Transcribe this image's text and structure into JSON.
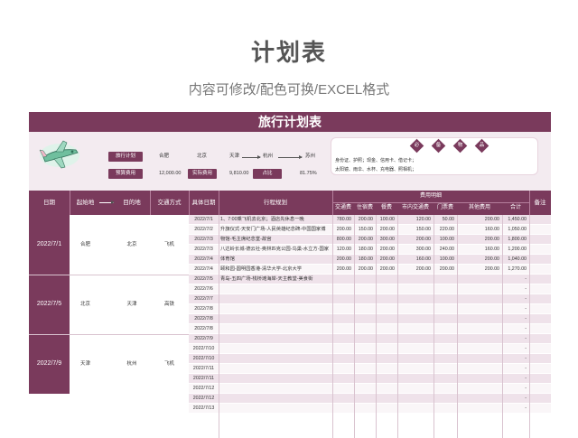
{
  "header": {
    "title": "计划表",
    "subtitle": "内容可修改/配色可换/EXCEL格式"
  },
  "sheet": {
    "banner_title": "旅行计划表",
    "summary": {
      "travel_plan_label": "旅行计划",
      "route": [
        "合肥",
        "北京",
        "天津",
        "杭州",
        "苏州"
      ],
      "budget_label": "预算费用",
      "budget_value": "12,000.00",
      "actual_label": "实际费用",
      "actual_value": "9,810.00",
      "ratio_label": "占比",
      "ratio_value": "81.75%"
    },
    "necessities": {
      "title_chars": [
        "必",
        "备",
        "物",
        "品"
      ],
      "line1": "身份证、护照；现金、信用卡、借记卡；",
      "line2": "太阳镜、雨伞、水杯、充电器、照相机；"
    },
    "columns": {
      "date": "日期",
      "origin": "起始地",
      "destination": "目的地",
      "transport": "交通方式",
      "specific_date": "具体日期",
      "itinerary": "行程规划",
      "expense_group": "费用明细",
      "expense_cols": [
        "交通费",
        "住宿费",
        "餐费",
        "市内交通费",
        "门票费",
        "其他费用",
        "合计"
      ],
      "remarks": "备注"
    },
    "groups": [
      {
        "date": "2022/7/1",
        "origin": "合肥",
        "destination": "北京",
        "transport": "飞机"
      },
      {
        "date": "2022/7/5",
        "origin": "北京",
        "destination": "天津",
        "transport": "高铁"
      },
      {
        "date": "2022/7/9",
        "origin": "天津",
        "destination": "杭州",
        "transport": "飞机"
      }
    ],
    "rows": [
      {
        "date": "2022/7/1",
        "plan": "1、7:00乘飞机去北京；酒店先休息一晚",
        "v": [
          "780.00",
          "200.00",
          "100.00",
          "120.00",
          "50.00",
          "200.00",
          "1,450.00"
        ]
      },
      {
        "date": "2022/7/2",
        "plan": "升旗仪式-天安门广场-人民英雄纪念碑-中国国家博",
        "v": [
          "200.00",
          "150.00",
          "200.00",
          "150.00",
          "220.00",
          "160.00",
          "1,050.00"
        ]
      },
      {
        "date": "2022/7/3",
        "plan": "物馆-毛主席纪念堂-故宫",
        "v": [
          "800.00",
          "200.00",
          "300.00",
          "200.00",
          "100.00",
          "200.00",
          "1,800.00"
        ]
      },
      {
        "date": "2022/7/3",
        "plan": "八达岭长城-德云社-奥林匹克公园-鸟巢-水立方-国家",
        "v": [
          "120.00",
          "180.00",
          "200.00",
          "300.00",
          "240.00",
          "160.00",
          "1,200.00"
        ]
      },
      {
        "date": "2022/7/4",
        "plan": "体育馆",
        "v": [
          "200.00",
          "180.00",
          "200.00",
          "160.00",
          "100.00",
          "200.00",
          "1,040.00"
        ]
      },
      {
        "date": "2022/7/4",
        "plan": "颐和园-圆明园香港-清华大学-北京大学",
        "v": [
          "200.00",
          "200.00",
          "200.00",
          "200.00",
          "200.00",
          "200.00",
          "1,270.00"
        ]
      },
      {
        "date": "2022/7/5",
        "plan": "青岛-五四广场-栈桥滩海岸-天主教堂-美食街",
        "v": [
          "",
          "",
          "",
          "",
          "",
          "",
          "-"
        ]
      },
      {
        "date": "2022/7/6",
        "plan": "",
        "v": [
          "",
          "",
          "",
          "",
          "",
          "",
          "-"
        ]
      },
      {
        "date": "2022/7/7",
        "plan": "",
        "v": [
          "",
          "",
          "",
          "",
          "",
          "",
          "-"
        ]
      },
      {
        "date": "2022/7/8",
        "plan": "",
        "v": [
          "",
          "",
          "",
          "",
          "",
          "",
          "-"
        ]
      },
      {
        "date": "2022/7/8",
        "plan": "",
        "v": [
          "",
          "",
          "",
          "",
          "",
          "",
          "-"
        ]
      },
      {
        "date": "2022/7/8",
        "plan": "",
        "v": [
          "",
          "",
          "",
          "",
          "",
          "",
          "-"
        ]
      },
      {
        "date": "2022/7/9",
        "plan": "",
        "v": [
          "",
          "",
          "",
          "",
          "",
          "",
          "-"
        ]
      },
      {
        "date": "2022/7/10",
        "plan": "",
        "v": [
          "",
          "",
          "",
          "",
          "",
          "",
          "-"
        ]
      },
      {
        "date": "2022/7/10",
        "plan": "",
        "v": [
          "",
          "",
          "",
          "",
          "",
          "",
          "-"
        ]
      },
      {
        "date": "2022/7/11",
        "plan": "",
        "v": [
          "",
          "",
          "",
          "",
          "",
          "",
          "-"
        ]
      },
      {
        "date": "2022/7/11",
        "plan": "",
        "v": [
          "",
          "",
          "",
          "",
          "",
          "",
          "-"
        ]
      },
      {
        "date": "2022/7/12",
        "plan": "",
        "v": [
          "",
          "",
          "",
          "",
          "",
          "",
          "-"
        ]
      },
      {
        "date": "2022/7/12",
        "plan": "",
        "v": [
          "",
          "",
          "",
          "",
          "",
          "",
          "-"
        ]
      },
      {
        "date": "2022/7/13",
        "plan": "",
        "v": [
          "",
          "",
          "",
          "",
          "",
          "",
          "-"
        ]
      }
    ],
    "colors": {
      "accent": "#7a3a5c",
      "row_alt": "#efe2ea",
      "panel": "#f3ebf0"
    }
  }
}
